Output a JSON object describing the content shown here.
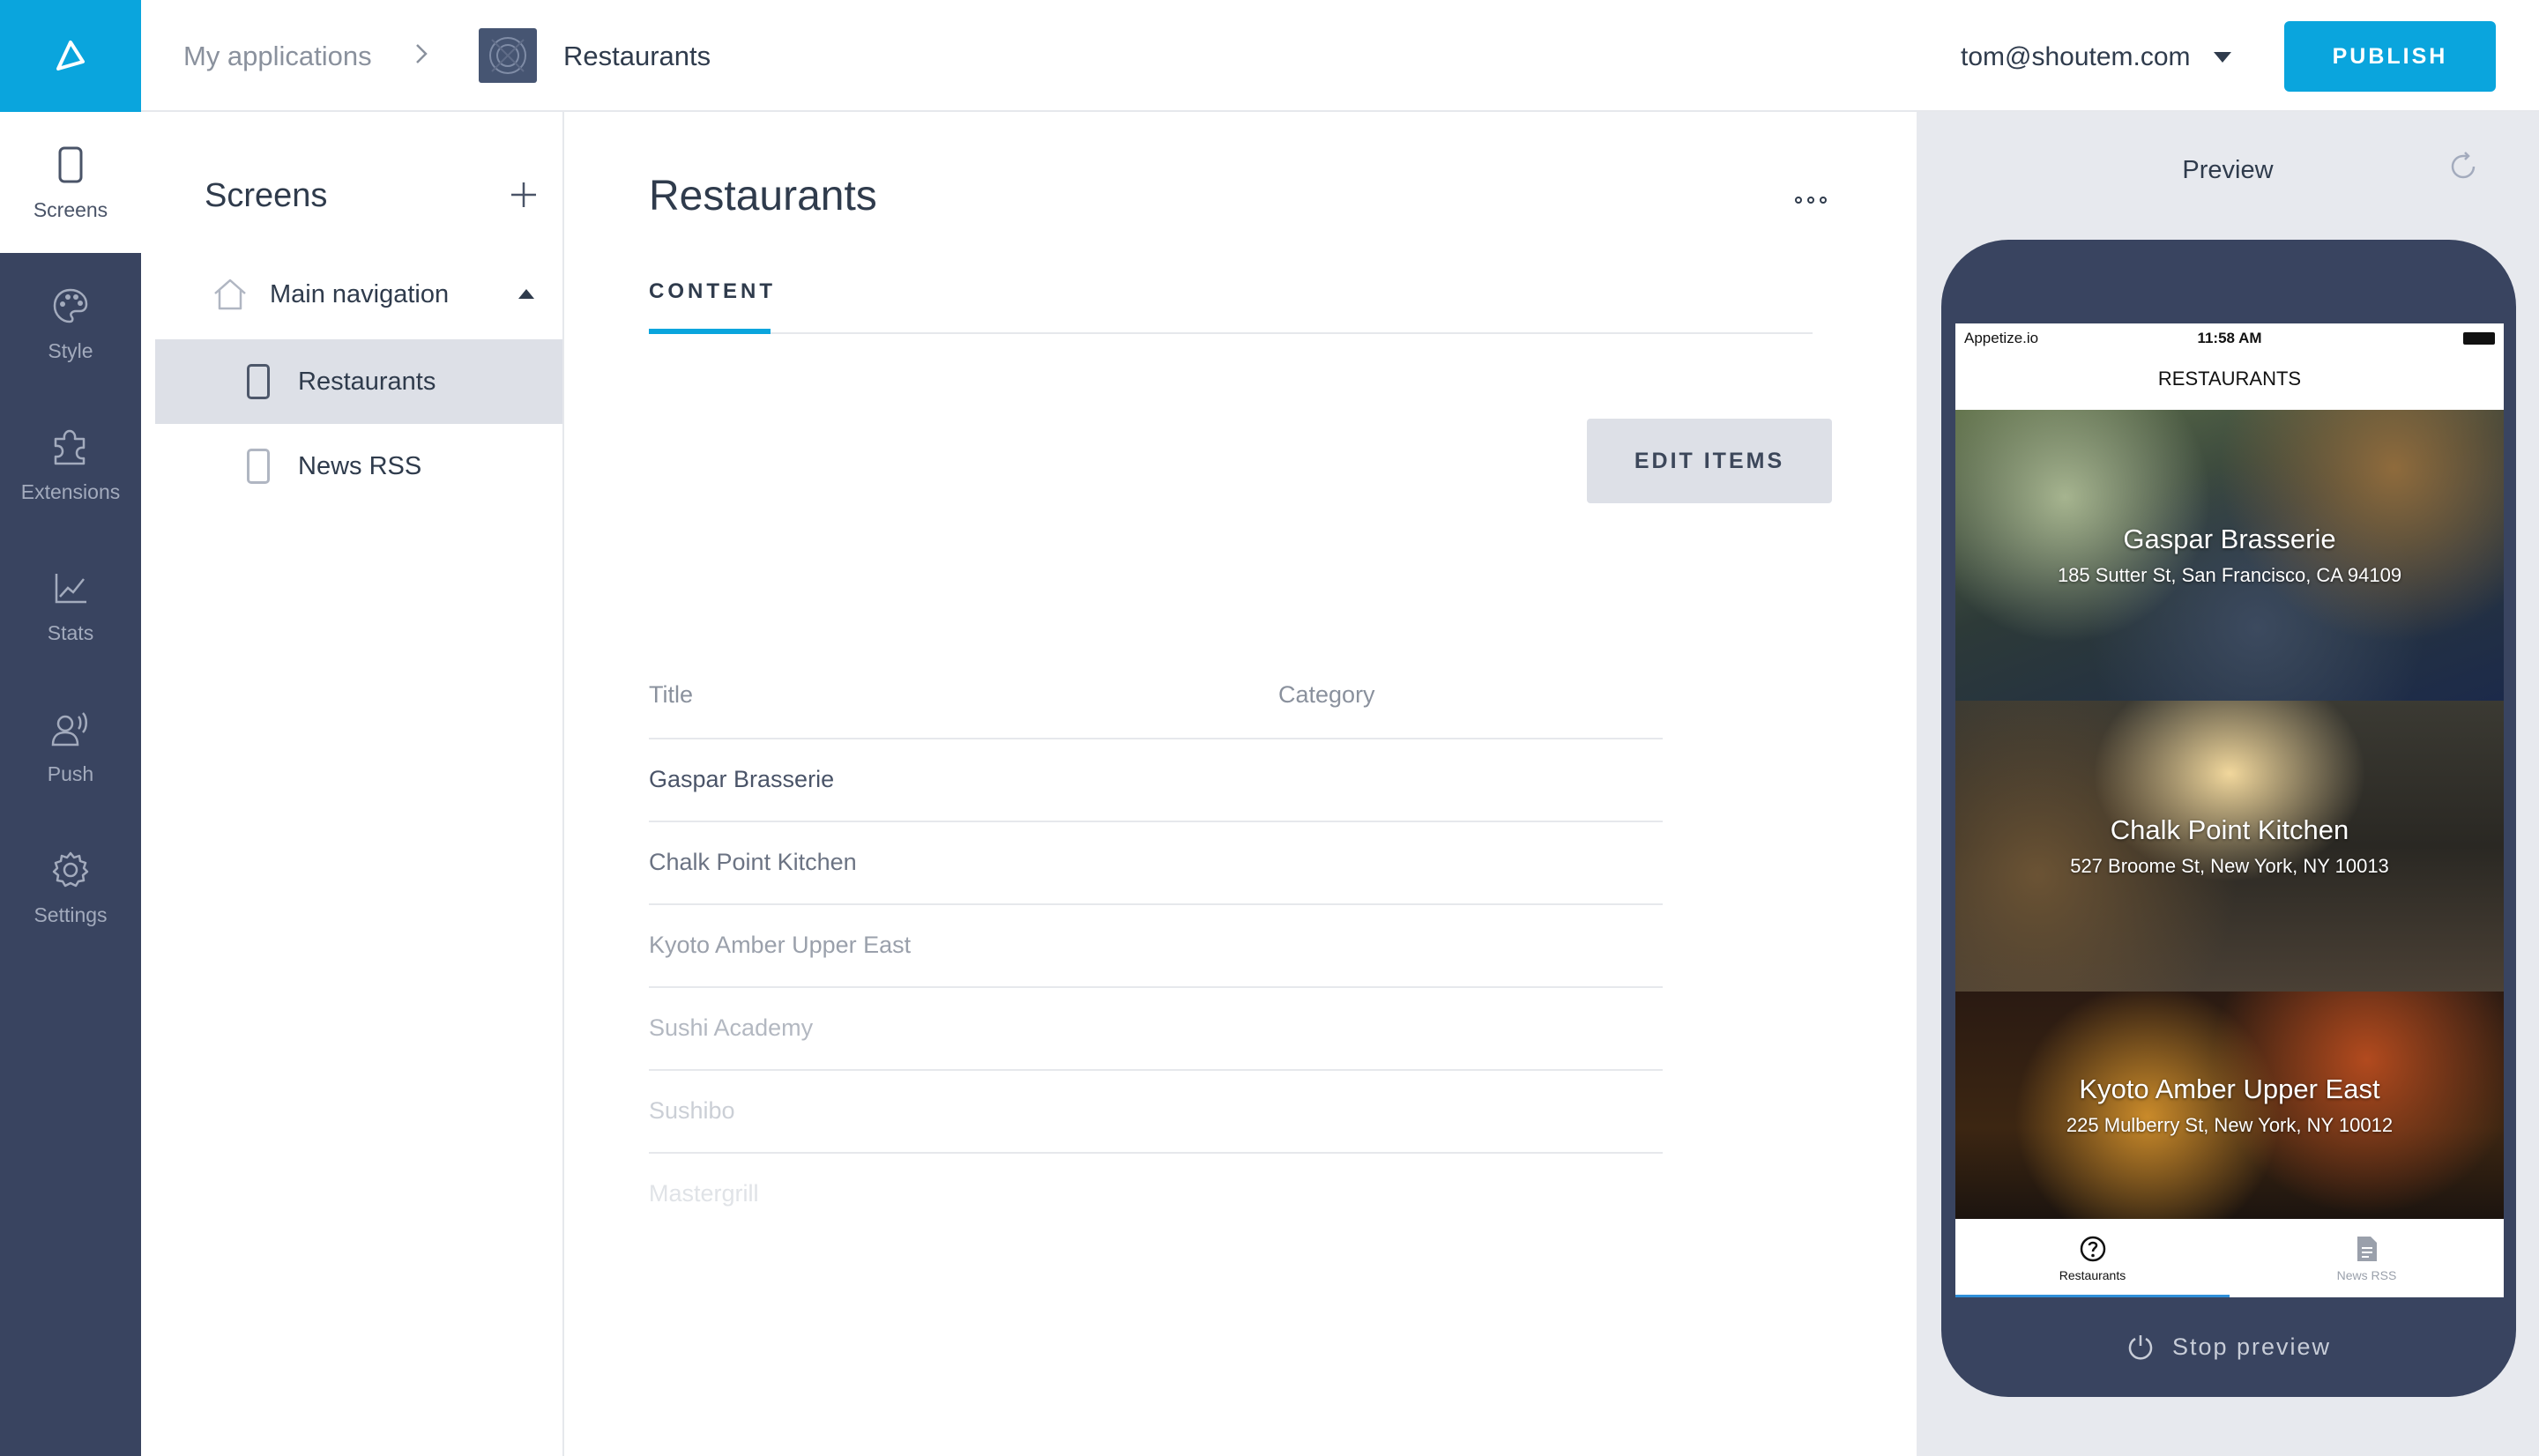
{
  "header": {
    "breadcrumb_root": "My applications",
    "app_name": "Restaurants",
    "user_email": "tom@shoutem.com",
    "publish_label": "PUBLISH"
  },
  "rail": {
    "items": [
      {
        "label": "Screens",
        "icon": "phone-icon",
        "active": true
      },
      {
        "label": "Style",
        "icon": "palette-icon",
        "active": false
      },
      {
        "label": "Extensions",
        "icon": "puzzle-icon",
        "active": false
      },
      {
        "label": "Stats",
        "icon": "chart-icon",
        "active": false
      },
      {
        "label": "Push",
        "icon": "broadcast-icon",
        "active": false
      },
      {
        "label": "Settings",
        "icon": "gear-icon",
        "active": false
      }
    ]
  },
  "screens_panel": {
    "title": "Screens",
    "group_label": "Main navigation",
    "screens": [
      {
        "label": "Restaurants",
        "selected": true
      },
      {
        "label": "News RSS",
        "selected": false
      }
    ]
  },
  "content": {
    "title": "Restaurants",
    "tab": "CONTENT",
    "edit_label": "EDIT ITEMS",
    "columns": [
      "Title",
      "Category"
    ],
    "rows": [
      {
        "title": "Gaspar Brasserie",
        "color": "#4a5468"
      },
      {
        "title": "Chalk Point Kitchen",
        "color": "#6b7383"
      },
      {
        "title": "Kyoto Amber Upper East",
        "color": "#9aa0ab"
      },
      {
        "title": "Sushi Academy",
        "color": "#b3b8c1"
      },
      {
        "title": "Sushibo",
        "color": "#cbcfd6"
      },
      {
        "title": "Mastergrill",
        "color": "#e0e3e7"
      }
    ]
  },
  "preview": {
    "title": "Preview",
    "carrier": "Appetize.io",
    "time": "11:58 AM",
    "nav_title": "RESTAURANTS",
    "cards": [
      {
        "name": "Gaspar Brasserie",
        "address": "185 Sutter St, San Francisco, CA 94109"
      },
      {
        "name": "Chalk Point Kitchen",
        "address": "527 Broome St, New York, NY 10013"
      },
      {
        "name": "Kyoto Amber Upper East",
        "address": "225 Mulberry St, New York, NY 10012"
      }
    ],
    "tabs": [
      {
        "label": "Restaurants",
        "active": true
      },
      {
        "label": "News RSS",
        "active": false
      }
    ],
    "stop_label": "Stop preview"
  },
  "colors": {
    "accent": "#0aa5dd",
    "rail_bg": "#394460",
    "text_dark": "#2f3b4c"
  }
}
